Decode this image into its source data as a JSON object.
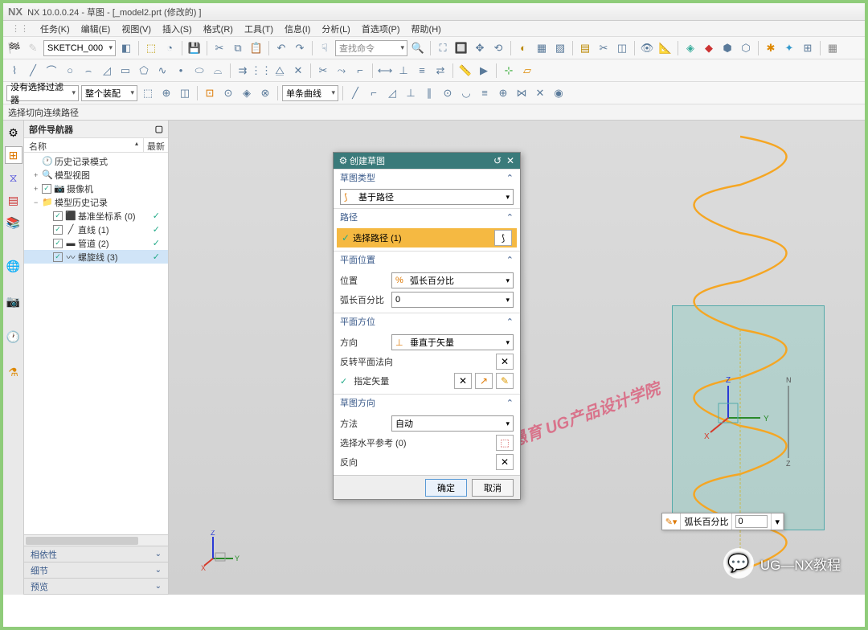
{
  "title": "NX 10.0.0.24 - 草图 - [_model2.prt  (修改的)  ]",
  "nx_logo": "NX",
  "menu": [
    "任务(K)",
    "编辑(E)",
    "视图(V)",
    "插入(S)",
    "格式(R)",
    "工具(T)",
    "信息(I)",
    "分析(L)",
    "首选项(P)",
    "帮助(H)"
  ],
  "toolbar1": {
    "sketch_combo": "SKETCH_000",
    "search_placeholder": "查找命令"
  },
  "toolbar3": {
    "filter1": "没有选择过滤器",
    "filter2": "整个装配",
    "curve_type": "单条曲线"
  },
  "status": "选择切向连续路径",
  "navigator": {
    "title": "部件导航器",
    "col1": "名称",
    "col2": "最新",
    "tree": [
      {
        "indent": 0,
        "icon": "🕐",
        "label": "历史记录模式",
        "chk": false,
        "ok": false
      },
      {
        "indent": 0,
        "icon": "🔍",
        "label": "模型视图",
        "chk": false,
        "ok": false,
        "exp": "+"
      },
      {
        "indent": 0,
        "icon": "📷",
        "label": "摄像机",
        "chk": true,
        "ok": false,
        "exp": "+"
      },
      {
        "indent": 0,
        "icon": "📁",
        "label": "模型历史记录",
        "chk": false,
        "ok": false,
        "exp": "−"
      },
      {
        "indent": 1,
        "icon": "⬛",
        "label": "基准坐标系 (0)",
        "chk": true,
        "ok": true
      },
      {
        "indent": 1,
        "icon": "╱",
        "label": "直线 (1)",
        "chk": true,
        "ok": true
      },
      {
        "indent": 1,
        "icon": "▬",
        "label": "管道 (2)",
        "chk": true,
        "ok": true
      },
      {
        "indent": 1,
        "icon": "〰",
        "label": "螺旋线 (3)",
        "chk": true,
        "ok": true,
        "sel": true
      }
    ],
    "accordion": [
      "相依性",
      "细节",
      "预览"
    ]
  },
  "dialog": {
    "title": "创建草图",
    "sections": {
      "type": {
        "head": "草图类型",
        "value": "基于路径"
      },
      "path": {
        "head": "路径",
        "select_label": "选择路径 (1)"
      },
      "plane_pos": {
        "head": "平面位置",
        "pos_label": "位置",
        "pos_value": "弧长百分比",
        "arc_label": "弧长百分比",
        "arc_value": "0"
      },
      "plane_dir": {
        "head": "平面方位",
        "dir_label": "方向",
        "dir_value": "垂直于矢量",
        "reverse_label": "反转平面法向",
        "vector_label": "指定矢量"
      },
      "sketch_dir": {
        "head": "草图方向",
        "method_label": "方法",
        "method_value": "自动",
        "horiz_label": "选择水平参考 (0)",
        "reverse_label": "反向"
      }
    },
    "ok": "确定",
    "cancel": "取消"
  },
  "popup": {
    "label": "弧长百分比",
    "value": "0"
  },
  "watermark": "愚育 UG产品设计学院",
  "wechat": "UG—NX教程",
  "triad": {
    "x": "X",
    "y": "Y",
    "z": "Z"
  }
}
